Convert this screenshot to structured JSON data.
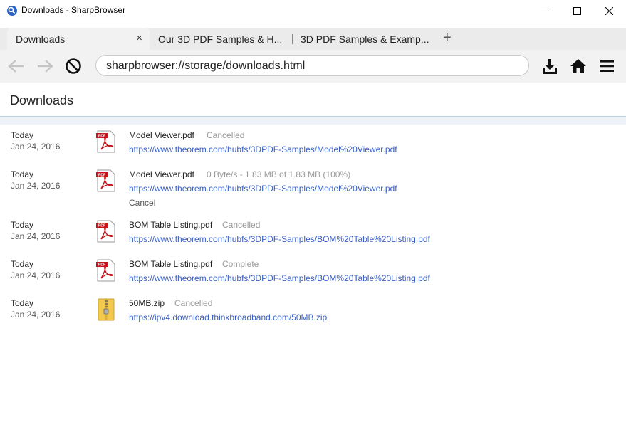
{
  "window": {
    "title": "Downloads - SharpBrowser",
    "controls": [
      "minimize-icon",
      "maximize-icon",
      "close-icon"
    ]
  },
  "tabs": [
    {
      "label": "Downloads",
      "active": true,
      "close": "×"
    },
    {
      "label": "Our 3D PDF Samples & H...",
      "active": false
    },
    {
      "label": "3D PDF Samples & Examp...",
      "active": false
    }
  ],
  "new_tab_label": "+",
  "toolbar": {
    "icons": [
      "back-arrow-icon",
      "forward-arrow-icon",
      "stop-icon",
      "download-icon",
      "home-icon",
      "menu-icon"
    ],
    "address": "sharpbrowser://storage/downloads.html"
  },
  "page": {
    "title": "Downloads",
    "items": [
      {
        "day": "Today",
        "date": "Jan 24, 2016",
        "file": "Model Viewer.pdf",
        "status": "Cancelled",
        "url": "https://www.theorem.com/hubfs/3DPDF-Samples/Model%20Viewer.pdf",
        "icon": "pdf-file-icon"
      },
      {
        "day": "Today",
        "date": "Jan 24, 2016",
        "file": "Model Viewer.pdf",
        "status": "0 Byte/s - 1.83 MB of 1.83 MB (100%)",
        "url": "https://www.theorem.com/hubfs/3DPDF-Samples/Model%20Viewer.pdf",
        "cancel": "Cancel",
        "icon": "pdf-file-icon"
      },
      {
        "day": "Today",
        "date": "Jan 24, 2016",
        "file": "BOM Table Listing.pdf",
        "status": "Cancelled",
        "url": "https://www.theorem.com/hubfs/3DPDF-Samples/BOM%20Table%20Listing.pdf",
        "icon": "pdf-file-icon"
      },
      {
        "day": "Today",
        "date": "Jan 24, 2016",
        "file": "BOM Table Listing.pdf",
        "status": "Complete",
        "url": "https://www.theorem.com/hubfs/3DPDF-Samples/BOM%20Table%20Listing.pdf",
        "icon": "pdf-file-icon"
      },
      {
        "day": "Today",
        "date": "Jan 24, 2016",
        "file": "50MB.zip",
        "status": "Cancelled",
        "url": "https://ipv4.download.thinkbroadband.com/50MB.zip",
        "icon": "zip-file-icon"
      }
    ]
  },
  "colors": {
    "link": "#3b5fc2",
    "status": "#999999",
    "pdf_red": "#c4161c",
    "zip_yellow": "#f2c94c"
  }
}
